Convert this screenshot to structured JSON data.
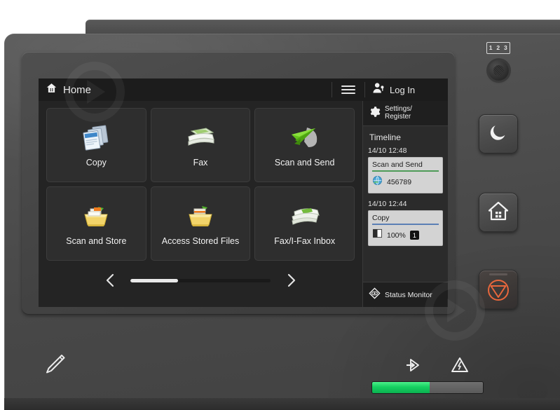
{
  "device": {
    "name": "multifunction-printer-control-panel"
  },
  "screen": {
    "topbar": {
      "home_label": "Home",
      "home_icon": "home-icon",
      "menu_icon": "hamburger-menu-icon",
      "login_label": "Log In",
      "login_icon": "user-login-icon"
    },
    "apps": [
      {
        "label": "Copy",
        "icon": "copy-documents-icon"
      },
      {
        "label": "Fax",
        "icon": "fax-machine-icon"
      },
      {
        "label": "Scan and Send",
        "icon": "scan-send-paperplane-icon"
      },
      {
        "label": "Scan and Store",
        "icon": "scan-store-box-icon"
      },
      {
        "label": "Access\nStored Files",
        "icon": "access-stored-files-box-icon"
      },
      {
        "label": "Fax/I-Fax Inbox",
        "icon": "fax-inbox-icon"
      }
    ],
    "pager": {
      "prev_icon": "chevron-left-icon",
      "next_icon": "chevron-right-icon",
      "progress_percent": 34
    },
    "sidebar": {
      "settings": {
        "label": "Settings/\nRegister",
        "icon": "gear-icon"
      },
      "timeline_title": "Timeline",
      "timeline": [
        {
          "time": "14/10 12:48",
          "job": "Scan and Send",
          "rule_color": "#4e9b58",
          "detail_icon": "globe-network-icon",
          "detail_value": "456789",
          "badge": ""
        },
        {
          "time": "14/10 12:44",
          "job": "Copy",
          "rule_color": "#5b7fb5",
          "detail_icon": "contrast-icon",
          "detail_value": "100%",
          "badge": "1"
        }
      ],
      "status_monitor": {
        "label": "Status Monitor",
        "icon": "status-monitor-diamond-icon"
      }
    }
  },
  "hardware": {
    "numeric_keys_label": [
      "1",
      "2",
      "3"
    ],
    "buttons": [
      {
        "name": "numeric-keypad-dial",
        "icon": "textured-round-knob-icon"
      },
      {
        "name": "energy-saver-button",
        "icon": "moon-icon"
      },
      {
        "name": "home-button",
        "icon": "house-icon"
      },
      {
        "name": "stop-button",
        "icon": "stop-triangle-icon"
      }
    ],
    "stylus_icon": "pen-stylus-icon",
    "indicators": [
      {
        "name": "data-processing-indicator",
        "icon": "arrow-into-box-icon"
      },
      {
        "name": "error-indicator",
        "icon": "warning-triangle-icon"
      }
    ],
    "power_led": {
      "name": "main-power-led",
      "lit_percent": 52,
      "color": "#16d061"
    }
  }
}
